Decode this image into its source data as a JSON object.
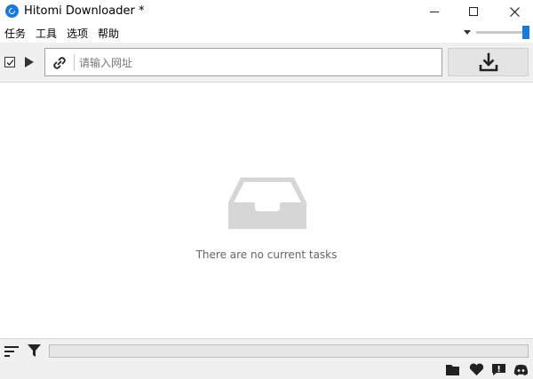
{
  "window": {
    "title": "Hitomi Downloader *",
    "app_icon": "hitomi-app-icon",
    "controls": [
      "minimize-icon",
      "maximize-icon",
      "close-icon"
    ]
  },
  "menu": {
    "items": [
      {
        "label": "任务"
      },
      {
        "label": "工具"
      },
      {
        "label": "选项"
      },
      {
        "label": "帮助"
      }
    ]
  },
  "toolbar": {
    "select_all_icon": "checkbox-checked-icon",
    "start_icon": "play-icon",
    "url_icon": "link-icon",
    "url_input": {
      "value": "",
      "placeholder": "请输入网址"
    },
    "download_icon": "download-icon"
  },
  "main": {
    "empty_icon": "inbox-tray-icon",
    "empty_message": "There are no current tasks"
  },
  "bottom": {
    "sort_icon": "sort-icon",
    "filter_icon": "filter-icon",
    "progress": 0
  },
  "status_icons": [
    "folder-icon",
    "heart-icon",
    "feedback-icon",
    "discord-icon"
  ],
  "colors": {
    "accent": "#1e78d7",
    "toolbar_bg": "#f0f0f0",
    "icon_dark": "#222222",
    "empty_icon": "#d6d6d6"
  }
}
